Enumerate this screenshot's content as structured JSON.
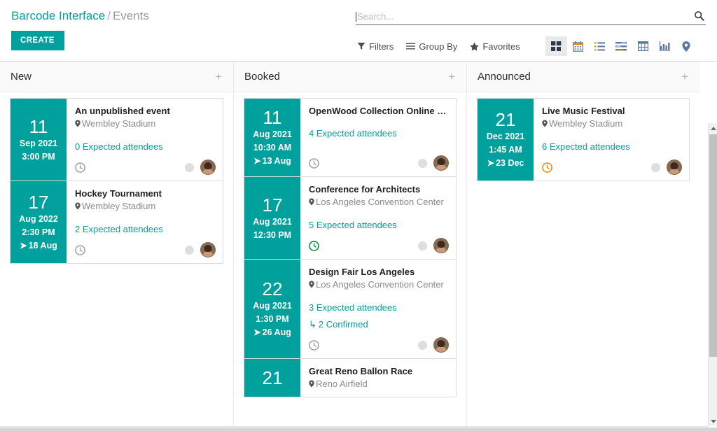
{
  "breadcrumb": {
    "root": "Barcode Interface",
    "separator": "/",
    "current": "Events"
  },
  "create_button": "CREATE",
  "search": {
    "placeholder": "Search...",
    "value": "",
    "icon": "search-icon"
  },
  "control_panel": {
    "menus": [
      {
        "label": "Filters",
        "icon": "filter-icon"
      },
      {
        "label": "Group By",
        "icon": "list-lines-icon"
      },
      {
        "label": "Favorites",
        "icon": "star-icon"
      }
    ],
    "view_switcher": [
      {
        "name": "kanban",
        "icon": "kanban-icon",
        "active": true
      },
      {
        "name": "calendar",
        "icon": "calendar-icon",
        "active": false
      },
      {
        "name": "list",
        "icon": "list-icon",
        "active": false
      },
      {
        "name": "gantt",
        "icon": "gantt-icon",
        "active": false
      },
      {
        "name": "pivot",
        "icon": "pivot-icon",
        "active": false
      },
      {
        "name": "graph",
        "icon": "graph-icon",
        "active": false
      },
      {
        "name": "map",
        "icon": "map-pin-icon",
        "active": false
      }
    ]
  },
  "colors": {
    "accent": "#00A09D",
    "date_panel": "#00A09D",
    "activity_planned": "#9e9e9e",
    "activity_today": "#00843a",
    "activity_overdue": "#e8860a"
  },
  "kanban": {
    "add_icon": "+",
    "columns": [
      {
        "title": "New",
        "cards": [
          {
            "day": "11",
            "month_year": "Sep 2021",
            "time": "3:00 PM",
            "end": "",
            "title": "An unpublished event",
            "location": "Wembley Stadium",
            "attendees": "0 Expected attendees",
            "confirmed": "",
            "activity_state": "planned"
          },
          {
            "day": "17",
            "month_year": "Aug 2022",
            "time": "2:30 PM",
            "end": "18 Aug",
            "title": "Hockey Tournament",
            "location": "Wembley Stadium",
            "attendees": "2 Expected attendees",
            "confirmed": "",
            "activity_state": "planned"
          }
        ]
      },
      {
        "title": "Booked",
        "cards": [
          {
            "day": "11",
            "month_year": "Aug 2021",
            "time": "10:30 AM",
            "end": "13 Aug",
            "title": "OpenWood Collection Online Re...",
            "location": "",
            "attendees": "4 Expected attendees",
            "confirmed": "",
            "activity_state": "planned"
          },
          {
            "day": "17",
            "month_year": "Aug 2021",
            "time": "12:30 PM",
            "end": "",
            "title": "Conference for Architects",
            "location": "Los Angeles Convention Center",
            "attendees": "5 Expected attendees",
            "confirmed": "",
            "activity_state": "today"
          },
          {
            "day": "22",
            "month_year": "Aug 2021",
            "time": "1:30 PM",
            "end": "26 Aug",
            "title": "Design Fair Los Angeles",
            "location": "Los Angeles Convention Center",
            "attendees": "3 Expected attendees",
            "confirmed": "2 Confirmed",
            "activity_state": "planned"
          },
          {
            "day": "21",
            "month_year": "",
            "time": "",
            "end": "",
            "title": "Great Reno Ballon Race",
            "location": "Reno Airfield",
            "attendees": "",
            "confirmed": "",
            "activity_state": "none"
          }
        ]
      },
      {
        "title": "Announced",
        "cards": [
          {
            "day": "21",
            "month_year": "Dec 2021",
            "time": "1:45 AM",
            "end": "23 Dec",
            "title": "Live Music Festival",
            "location": "Wembley Stadium",
            "attendees": "6 Expected attendees",
            "confirmed": "",
            "activity_state": "overdue"
          }
        ]
      }
    ]
  }
}
